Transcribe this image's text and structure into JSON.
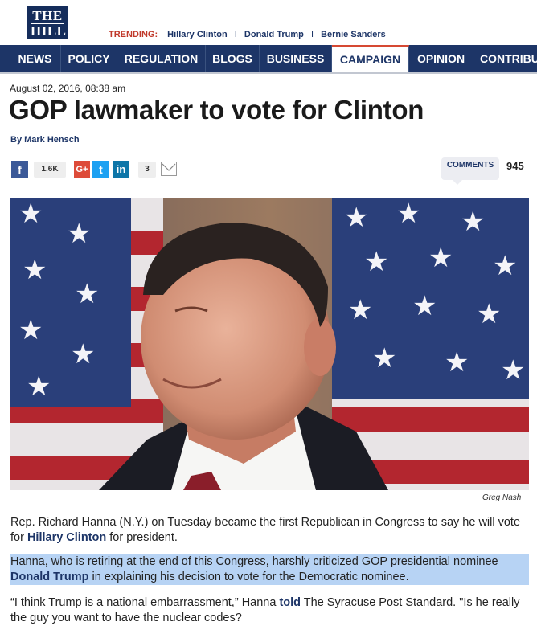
{
  "site": {
    "logo_line1": "THE",
    "logo_line2": "HILL"
  },
  "trending": {
    "label": "TRENDING:",
    "items": [
      "Hillary Clinton",
      "Donald Trump",
      "Bernie Sanders"
    ],
    "separator": "I"
  },
  "nav": {
    "items": [
      "NEWS",
      "POLICY",
      "REGULATION",
      "BLOGS",
      "BUSINESS",
      "CAMPAIGN",
      "OPINION",
      "CONTRIBU"
    ],
    "active": "CAMPAIGN"
  },
  "article": {
    "date": "August 02, 2016, 08:38 am",
    "headline": "GOP lawmaker to vote for Clinton",
    "byline": "By Mark Hensch",
    "photo_credit": "Greg Nash"
  },
  "share": {
    "facebook_glyph": "f",
    "facebook_count": "1.6K",
    "googleplus_glyph": "G+",
    "twitter_glyph": "t",
    "linkedin_glyph": "in",
    "linkedin_count": "3",
    "comments_label": "COMMENTS",
    "comments_count": "945"
  },
  "body": {
    "p1_a": "Rep. Richard Hanna (N.Y.) on Tuesday became the first Republican in Congress to say he will vote for ",
    "p1_link": "Hillary Clinton",
    "p1_b": " for president.",
    "p2_a": "Hanna, who is retiring at the end of this Congress, harshly criticized GOP presidential nominee ",
    "p2_link": "Donald Trump",
    "p2_b": " in explaining his decision to vote for the Democratic nominee.",
    "p3_a": "“I think Trump is a national embarrassment,” Hanna ",
    "p3_link": "told",
    "p3_b": " The Syracuse Post Standard. \"Is he really the guy you want to have the nuclear codes?"
  },
  "icons": {
    "facebook": "facebook-icon",
    "googleplus": "google-plus-icon",
    "twitter": "twitter-icon",
    "linkedin": "linkedin-icon",
    "email": "email-icon"
  },
  "colors": {
    "brand_navy": "#1d3567",
    "trending_red": "#c0392b",
    "active_tab_accent": "#d64933",
    "highlight": "#b7d3f4"
  }
}
